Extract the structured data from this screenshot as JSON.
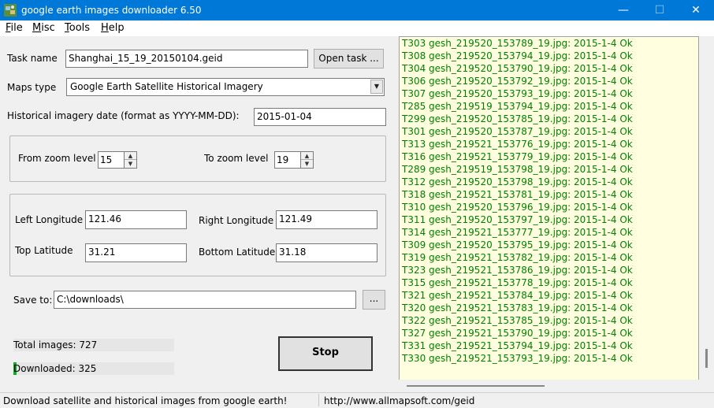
{
  "window": {
    "title": "google earth images downloader 6.50"
  },
  "menu": [
    {
      "key": "F",
      "rest": "ile"
    },
    {
      "key": "M",
      "rest": "isc"
    },
    {
      "key": "T",
      "rest": "ools"
    },
    {
      "key": "H",
      "rest": "elp"
    }
  ],
  "task": {
    "label": "Task name",
    "value": "Shanghai_15_19_20150104.geid",
    "open_button": "Open task ..."
  },
  "maps": {
    "label": "Maps type",
    "selected": "Google Earth Satellite Historical Imagery"
  },
  "historical": {
    "label": "Historical imagery date (format as YYYY-MM-DD):",
    "value": "2015-01-04"
  },
  "zoom": {
    "from_label": "From zoom level",
    "from_value": "15",
    "to_label": "To zoom level",
    "to_value": "19"
  },
  "coords": {
    "left_lon_label": "Left Longitude",
    "left_lon": "121.46",
    "right_lon_label": "Right Longitude",
    "right_lon": "121.49",
    "top_lat_label": "Top Latitude",
    "top_lat": "31.21",
    "bottom_lat_label": "Bottom Latitude",
    "bottom_lat": "31.18"
  },
  "save": {
    "label": "Save to:",
    "path": "C:\\downloads\\",
    "browse": "..."
  },
  "stats": {
    "total": "Total images: 727",
    "downloaded": "Downloaded: 325",
    "downloaded_progress": 0.02
  },
  "stop_button": "Stop",
  "log": [
    "T303 gesh_219520_153789_19.jpg: 2015-1-4 Ok",
    "T308 gesh_219520_153794_19.jpg: 2015-1-4 Ok",
    "T304 gesh_219520_153790_19.jpg: 2015-1-4 Ok",
    "T306 gesh_219520_153792_19.jpg: 2015-1-4 Ok",
    "T307 gesh_219520_153793_19.jpg: 2015-1-4 Ok",
    "T285 gesh_219519_153794_19.jpg: 2015-1-4 Ok",
    "T299 gesh_219520_153785_19.jpg: 2015-1-4 Ok",
    "T301 gesh_219520_153787_19.jpg: 2015-1-4 Ok",
    "T313 gesh_219521_153776_19.jpg: 2015-1-4 Ok",
    "T316 gesh_219521_153779_19.jpg: 2015-1-4 Ok",
    "T289 gesh_219519_153798_19.jpg: 2015-1-4 Ok",
    "T312 gesh_219520_153798_19.jpg: 2015-1-4 Ok",
    "T318 gesh_219521_153781_19.jpg: 2015-1-4 Ok",
    "T310 gesh_219520_153796_19.jpg: 2015-1-4 Ok",
    "T311 gesh_219520_153797_19.jpg: 2015-1-4 Ok",
    "T314 gesh_219521_153777_19.jpg: 2015-1-4 Ok",
    "T309 gesh_219520_153795_19.jpg: 2015-1-4 Ok",
    "T319 gesh_219521_153782_19.jpg: 2015-1-4 Ok",
    "T323 gesh_219521_153786_19.jpg: 2015-1-4 Ok",
    "T315 gesh_219521_153778_19.jpg: 2015-1-4 Ok",
    "T321 gesh_219521_153784_19.jpg: 2015-1-4 Ok",
    "T320 gesh_219521_153783_19.jpg: 2015-1-4 Ok",
    "T322 gesh_219521_153785_19.jpg: 2015-1-4 Ok",
    "T327 gesh_219521_153790_19.jpg: 2015-1-4 Ok",
    "T331 gesh_219521_153794_19.jpg: 2015-1-4 Ok",
    "T330 gesh_219521_153793_19.jpg: 2015-1-4 Ok"
  ],
  "status": {
    "left": "Download satellite and historical  images from google earth!",
    "right": "http://www.allmapsoft.com/geid"
  },
  "colors": {
    "titlebar": "#0078d7",
    "log_bg": "#ffffe0",
    "log_text": "#008000"
  }
}
